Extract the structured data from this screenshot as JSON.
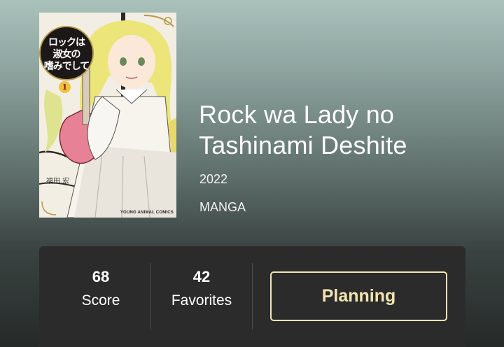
{
  "cover": {
    "title": "ロックは\n淑女の\n嗜みでして",
    "volume": "1",
    "author": "福田 宏",
    "imprint": "YOUNG ANIMAL COMICS"
  },
  "media": {
    "title": "Rock wa Lady no Tashinami Deshite",
    "year": "2022",
    "format": "MANGA"
  },
  "stats": {
    "score": {
      "value": "68",
      "label": "Score"
    },
    "favorites": {
      "value": "42",
      "label": "Favorites"
    }
  },
  "actions": {
    "status_label": "Planning"
  },
  "colors": {
    "accent": "#f3e4b0",
    "card_background": "#2b2b2b"
  }
}
